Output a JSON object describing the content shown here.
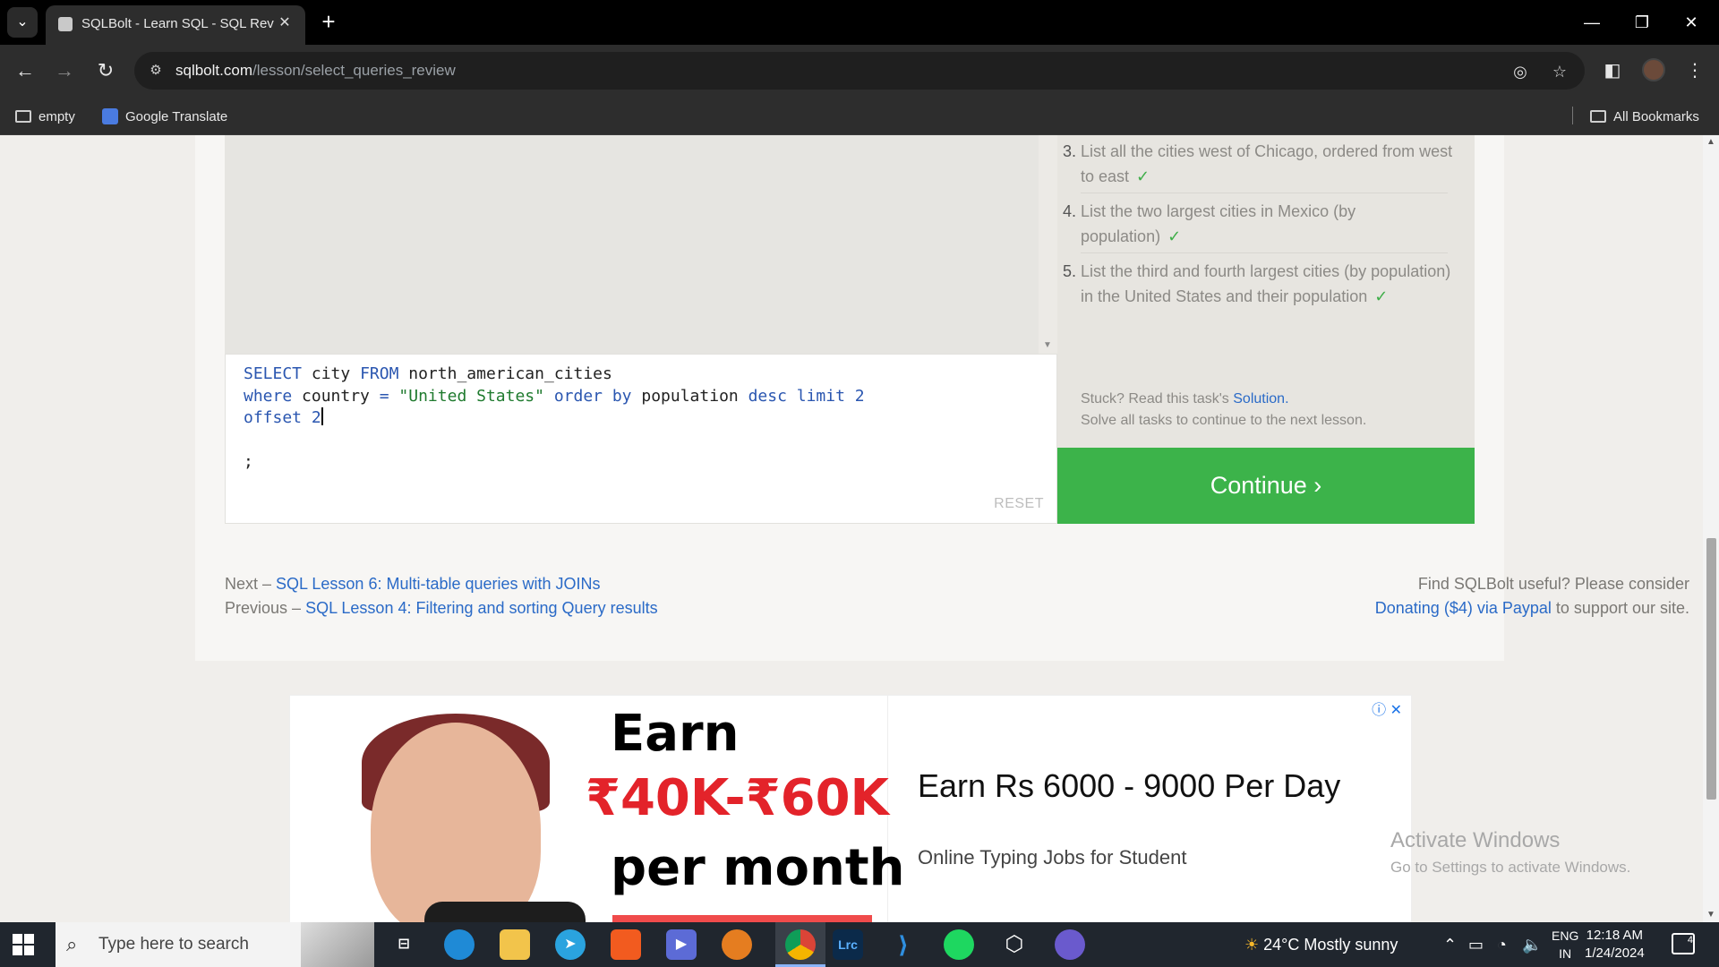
{
  "browser": {
    "tab_title": "SQLBolt - Learn SQL - SQL Review",
    "url_host": "sqlbolt.com",
    "url_path": "/lesson/select_queries_review",
    "bookmarks": [
      "empty",
      "Google Translate"
    ],
    "all_bookmarks": "All Bookmarks"
  },
  "lesson": {
    "tasks": [
      {
        "num": "3.",
        "text": "List all the cities west of Chicago, ordered from west to east",
        "check": "✓"
      },
      {
        "num": "4.",
        "text": "List the two largest cities in Mexico (by population)",
        "check": "✓"
      },
      {
        "num": "5.",
        "text": "List the third and fourth largest cities (by population) in the United States and their population",
        "check": "✓"
      }
    ],
    "stuck_prefix": "Stuck? Read this task's",
    "solution_link": "Solution.",
    "solve_all": "Solve all tasks to continue to the next lesson.",
    "continue_label": "Continue ›",
    "reset_label": "RESET",
    "editor": {
      "line1": {
        "kw1": "SELECT",
        "t1": " city ",
        "kw2": "FROM",
        "t2": " north_american_cities"
      },
      "line2": {
        "kw1": "where",
        "t1": " country ",
        "op": "=",
        "str": "\"United States\"",
        "kw2": "order by",
        "t2": " population ",
        "kw3": "desc limit",
        "num": "2"
      },
      "line3": {
        "kw1": "offset",
        "num": "2"
      },
      "line5": ";"
    }
  },
  "footer": {
    "next_prefix": "Next –",
    "next_link": "SQL Lesson 6: Multi-table queries with JOINs",
    "prev_prefix": "Previous –",
    "prev_link": "SQL Lesson 4: Filtering and sorting Query results",
    "support_line1": "Find SQLBolt useful? Please consider",
    "support_link": "Donating ($4) via Paypal",
    "support_suffix": "to support our site."
  },
  "ad": {
    "earn": "Earn",
    "amount": "₹40K-₹60K",
    "per_month": "per month",
    "headline": "Earn Rs 6000 - 9000 Per Day",
    "subline": "Online Typing Jobs for Student",
    "info_icons": "ⓘ ✕"
  },
  "watermark": {
    "line1": "Activate Windows",
    "line2": "Go to Settings to activate Windows."
  },
  "taskbar": {
    "search_placeholder": "Type here to search",
    "weather": "24°C  Mostly sunny",
    "lang_top": "ENG",
    "lang_bottom": "IN",
    "time": "12:18 AM",
    "date": "1/24/2024",
    "notif_count": "4"
  }
}
